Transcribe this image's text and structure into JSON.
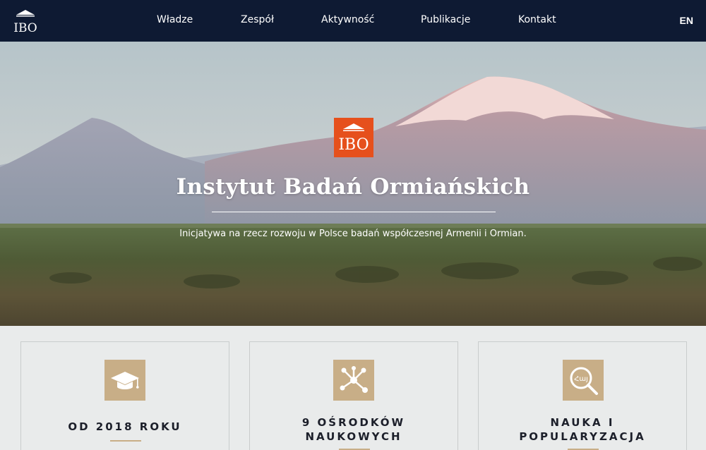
{
  "nav": {
    "logo_text": "IBO",
    "links": [
      "Władze",
      "Zespół",
      "Aktywność",
      "Publikacje",
      "Kontakt"
    ],
    "lang": "EN"
  },
  "hero": {
    "badge_text": "IBO",
    "title": "Instytut Badań Ormiańskich",
    "subtitle": "Inicjatywa na rzecz rozwoju w Polsce badań współczesnej Armenii i Ormian."
  },
  "cards": [
    {
      "icon": "graduation-cap-icon",
      "title_lines": [
        "OD 2018 ROKU"
      ]
    },
    {
      "icon": "network-nodes-icon",
      "title_lines": [
        "9 OŚRODKÓW",
        "NAUKOWYCH"
      ]
    },
    {
      "icon": "magnifier-armenian-icon",
      "title_lines": [
        "NAUKA I",
        "POPULARYZACJA"
      ],
      "icon_glyph": "Հայ"
    }
  ],
  "colors": {
    "nav_bg": "#0e1a33",
    "badge_orange": "#e6501c",
    "card_accent": "#c8ae87",
    "page_bg": "#e9ebeb"
  }
}
